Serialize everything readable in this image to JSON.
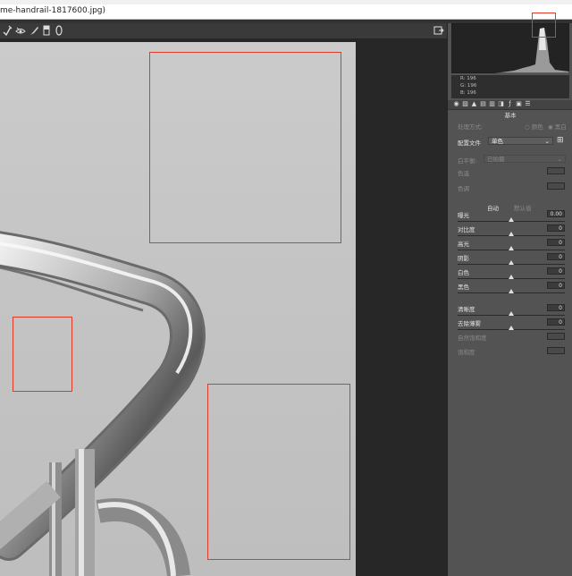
{
  "window": {
    "title": "me-handrail-1817600.jpg)"
  },
  "menu": {
    "items": [
      "",
      "",
      "",
      "",
      ""
    ]
  },
  "histogram": {
    "r_label": "R:",
    "r_value": "196",
    "g_label": "G:",
    "g_value": "196",
    "b_label": "B:",
    "b_value": "196"
  },
  "panel": {
    "section_title": "基本",
    "treatment_label": "处理方式:",
    "treatment_color": "颜色",
    "treatment_bw": "黑白",
    "profile_label": "配置文件",
    "profile_value": "单色",
    "wb_label": "白平衡:",
    "wb_value": "已拍摄",
    "temp_label": "色温",
    "tint_label": "色调",
    "auto_label": "自动",
    "default_label": "默认值",
    "sliders": [
      {
        "name": "曝光",
        "value": "0.00",
        "enabled": true
      },
      {
        "name": "对比度",
        "value": "0",
        "enabled": true
      },
      {
        "name": "高光",
        "value": "0",
        "enabled": true
      },
      {
        "name": "阴影",
        "value": "0",
        "enabled": true
      },
      {
        "name": "白色",
        "value": "0",
        "enabled": true
      },
      {
        "name": "黑色",
        "value": "0",
        "enabled": true
      },
      {
        "name": "清晰度",
        "value": "0",
        "enabled": true
      },
      {
        "name": "去除薄雾",
        "value": "0",
        "enabled": true
      },
      {
        "name": "自然饱和度",
        "value": "",
        "enabled": false
      },
      {
        "name": "饱和度",
        "value": "",
        "enabled": false
      }
    ]
  },
  "colors": {
    "highlight_box": "#e03a2a",
    "panel_bg": "#535353"
  }
}
